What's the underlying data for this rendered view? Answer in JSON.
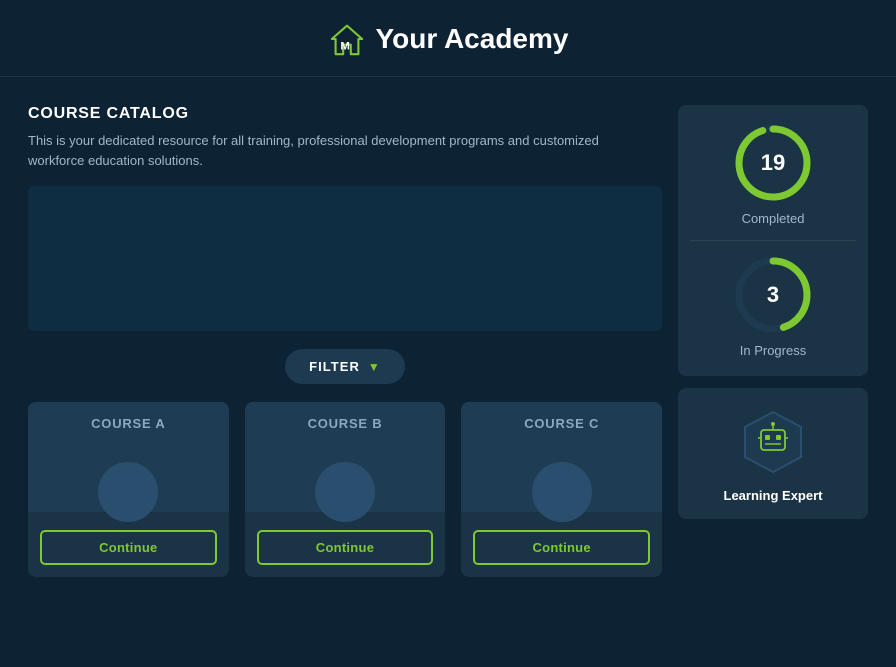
{
  "header": {
    "title": "Your Academy",
    "logo_alt": "academy-logo"
  },
  "catalog": {
    "title": "COURSE CATALOG",
    "description": "This is your dedicated resource for all training, professional development programs and customized workforce education solutions."
  },
  "filter": {
    "label": "FILTER"
  },
  "courses": [
    {
      "title": "COURSE A",
      "continue_label": "Continue"
    },
    {
      "title": "COURSE B",
      "continue_label": "Continue"
    },
    {
      "title": "COURSE C",
      "continue_label": "Continue"
    }
  ],
  "stats": {
    "completed": {
      "value": "19",
      "label": "Completed",
      "percent": 95
    },
    "in_progress": {
      "value": "3",
      "label": "In Progress",
      "percent": 45
    }
  },
  "expert": {
    "label": "Learning Expert"
  },
  "colors": {
    "accent_green": "#7ec832",
    "ring_bg": "#1e3a50",
    "ring_stroke": "#7ec832"
  }
}
